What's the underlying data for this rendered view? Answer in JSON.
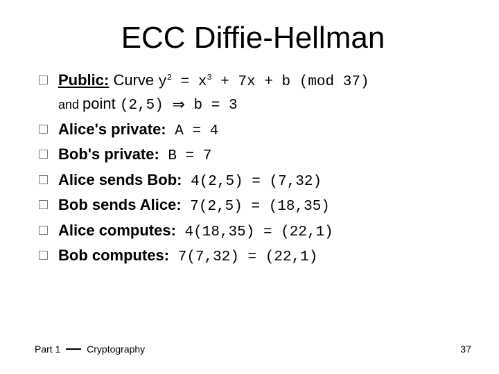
{
  "title": "ECC Diffie-Hellman",
  "bullets": {
    "b0_label": "Public:",
    "b0_mid1": " Curve ",
    "b0_eq_y": "y",
    "b0_sup2a": "2",
    "b0_eq_mid": " = x",
    "b0_sup3": "3",
    "b0_eq_tail": " + 7x + b (mod 37)",
    "b0_and": "and ",
    "b0_point": "point ",
    "b0_pt": "(2,5) ",
    "b0_end": " b = 3",
    "b1_label": "Alice's private:",
    "b1_val": " A = 4",
    "b2_label": "Bob's private:",
    "b2_val": " B = 7",
    "b3_label": "Alice sends Bob:",
    "b3_val": " 4(2,5) = (7,32)",
    "b4_label": "Bob sends Alice:",
    "b4_val": " 7(2,5) = (18,35)",
    "b5_label": "Alice computes:",
    "b5_val": " 4(18,35) = (22,1)",
    "b6_label": "Bob computes:",
    "b6_val": " 7(7,32) = (22,1)"
  },
  "footer": {
    "part": "Part 1 ",
    "topic": " Cryptography"
  },
  "page": "37"
}
